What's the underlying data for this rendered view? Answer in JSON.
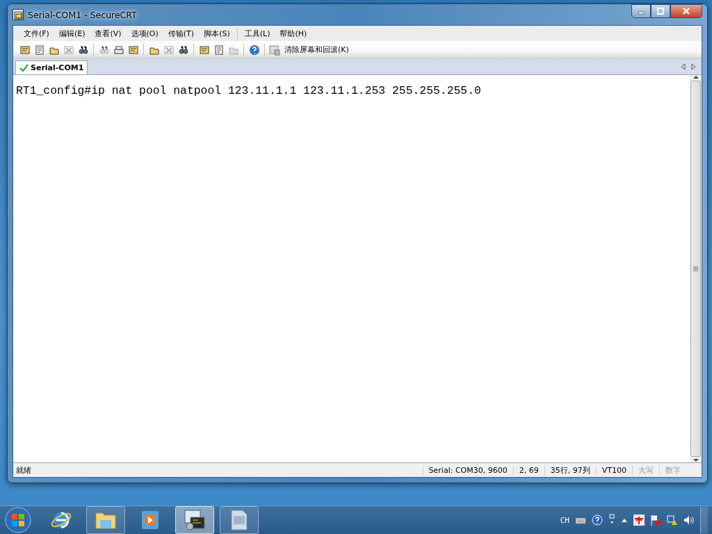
{
  "window": {
    "title": "Serial-COM1 - SecureCRT"
  },
  "menu": [
    {
      "label": "文件(F)",
      "separator_before": false
    },
    {
      "label": "编辑(E)",
      "separator_before": false
    },
    {
      "label": "查看(V)",
      "separator_before": false
    },
    {
      "label": "选项(O)",
      "separator_before": false
    },
    {
      "label": "传输(T)",
      "separator_before": false
    },
    {
      "label": "脚本(S)",
      "separator_before": false
    },
    {
      "label": "工具(L)",
      "separator_before": true
    },
    {
      "label": "帮助(H)",
      "separator_before": false
    }
  ],
  "toolbar": {
    "groups": [
      [
        {
          "disabled": false
        },
        {
          "disabled": false
        },
        {
          "disabled": false
        },
        {
          "disabled": true
        },
        {
          "disabled": false
        }
      ],
      [
        {
          "disabled": true
        },
        {
          "disabled": false
        },
        {
          "disabled": false
        }
      ],
      [
        {
          "disabled": false
        },
        {
          "disabled": true
        },
        {
          "disabled": false
        }
      ],
      [
        {
          "disabled": false
        },
        {
          "disabled": false
        },
        {
          "disabled": true
        }
      ],
      [
        {
          "disabled": false
        }
      ]
    ],
    "text_button": "清除屏幕和回滚(K)"
  },
  "tabs": [
    {
      "label": "Serial-COM1",
      "selected": true,
      "connected": true
    }
  ],
  "terminal": {
    "lines": [
      "RT1_config#ip nat pool natpool 123.11.1.1 123.11.1.253 255.255.255.0"
    ]
  },
  "status_bar": {
    "message": "就绪",
    "panes": [
      {
        "text": "Serial: COM30, 9600",
        "disabled": false
      },
      {
        "text": "2,  69",
        "disabled": false
      },
      {
        "text": "35行, 97列",
        "disabled": false
      },
      {
        "text": "VT100",
        "disabled": false
      },
      {
        "text": "大写",
        "disabled": true
      },
      {
        "text": "数字",
        "disabled": true
      }
    ]
  },
  "taskbar": {
    "apps": [
      {
        "kind": "browser",
        "open": false,
        "selected": false
      },
      {
        "kind": "folder",
        "open": true,
        "selected": false
      },
      {
        "kind": "media",
        "open": false,
        "selected": false
      },
      {
        "kind": "terminal",
        "open": true,
        "selected": true
      },
      {
        "kind": "document",
        "open": true,
        "selected": false
      }
    ],
    "tray": {
      "language": "CH"
    }
  }
}
